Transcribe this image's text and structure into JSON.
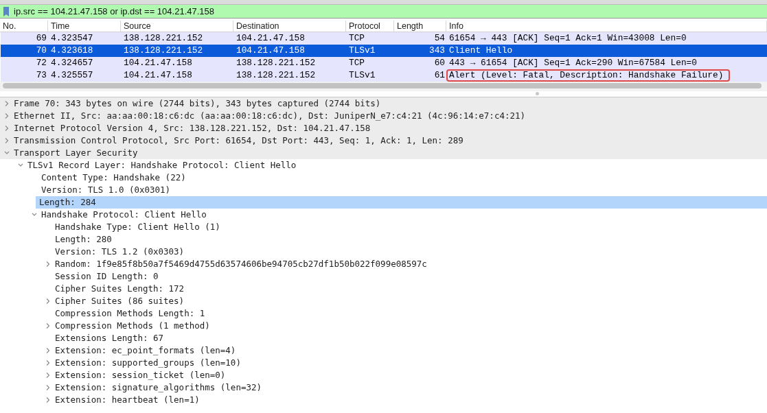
{
  "display_filter": {
    "value": "ip.src == 104.21.47.158 or ip.dst == 104.21.47.158"
  },
  "packet_list": {
    "columns": [
      "No.",
      "Time",
      "Source",
      "Destination",
      "Protocol",
      "Length",
      "Info"
    ],
    "rows": [
      {
        "no": "69",
        "time": "4.323547",
        "source": "138.128.221.152",
        "destination": "104.21.47.158",
        "protocol": "TCP",
        "length": "54",
        "info": "61654 → 443 [ACK] Seq=1 Ack=1 Win=43008 Len=0",
        "selected": false,
        "annotated": false
      },
      {
        "no": "70",
        "time": "4.323618",
        "source": "138.128.221.152",
        "destination": "104.21.47.158",
        "protocol": "TLSv1",
        "length": "343",
        "info": "Client Hello",
        "selected": true,
        "annotated": false
      },
      {
        "no": "72",
        "time": "4.324657",
        "source": "104.21.47.158",
        "destination": "138.128.221.152",
        "protocol": "TCP",
        "length": "60",
        "info": "443 → 61654 [ACK] Seq=1 Ack=290 Win=67584 Len=0",
        "selected": false,
        "annotated": false
      },
      {
        "no": "73",
        "time": "4.325557",
        "source": "104.21.47.158",
        "destination": "138.128.221.152",
        "protocol": "TLSv1",
        "length": "61",
        "info": "Alert (Level: Fatal, Description: Handshake Failure)",
        "selected": false,
        "annotated": true
      }
    ]
  },
  "packet_details": [
    {
      "label": "Frame 70: 343 bytes on wire (2744 bits), 343 bytes captured (2744 bits)",
      "expanded": false,
      "selected": false
    },
    {
      "label": "Ethernet II, Src: aa:aa:00:18:c6:dc (aa:aa:00:18:c6:dc), Dst: JuniperN_e7:c4:21 (4c:96:14:e7:c4:21)",
      "expanded": false,
      "selected": false
    },
    {
      "label": "Internet Protocol Version 4, Src: 138.128.221.152, Dst: 104.21.47.158",
      "expanded": false,
      "selected": false
    },
    {
      "label": "Transmission Control Protocol, Src Port: 61654, Dst Port: 443, Seq: 1, Ack: 1, Len: 289",
      "expanded": false,
      "selected": false
    },
    {
      "label": "Transport Layer Security",
      "expanded": true,
      "selected": false,
      "children": [
        {
          "label": "TLSv1 Record Layer: Handshake Protocol: Client Hello",
          "expanded": true,
          "selected": false,
          "children": [
            {
              "label": "Content Type: Handshake (22)",
              "selected": false
            },
            {
              "label": "Version: TLS 1.0 (0x0301)",
              "selected": false
            },
            {
              "label": "Length: 284",
              "selected": true
            },
            {
              "label": "Handshake Protocol: Client Hello",
              "expanded": true,
              "selected": false,
              "children": [
                {
                  "label": "Handshake Type: Client Hello (1)",
                  "selected": false
                },
                {
                  "label": "Length: 280",
                  "selected": false
                },
                {
                  "label": "Version: TLS 1.2 (0x0303)",
                  "selected": false
                },
                {
                  "label": "Random: 1f9e85f8b50a7f5469d4755d63574606be94705cb27df1b50b022f099e08597c",
                  "expanded": false,
                  "selected": false
                },
                {
                  "label": "Session ID Length: 0",
                  "selected": false
                },
                {
                  "label": "Cipher Suites Length: 172",
                  "selected": false
                },
                {
                  "label": "Cipher Suites (86 suites)",
                  "expanded": false,
                  "selected": false
                },
                {
                  "label": "Compression Methods Length: 1",
                  "selected": false
                },
                {
                  "label": "Compression Methods (1 method)",
                  "expanded": false,
                  "selected": false
                },
                {
                  "label": "Extensions Length: 67",
                  "selected": false
                },
                {
                  "label": "Extension: ec_point_formats (len=4)",
                  "expanded": false,
                  "selected": false
                },
                {
                  "label": "Extension: supported_groups (len=10)",
                  "expanded": false,
                  "selected": false
                },
                {
                  "label": "Extension: session_ticket (len=0)",
                  "expanded": false,
                  "selected": false
                },
                {
                  "label": "Extension: signature_algorithms (len=32)",
                  "expanded": false,
                  "selected": false
                },
                {
                  "label": "Extension: heartbeat (len=1)",
                  "expanded": false,
                  "selected": false
                }
              ]
            }
          ]
        }
      ]
    }
  ]
}
